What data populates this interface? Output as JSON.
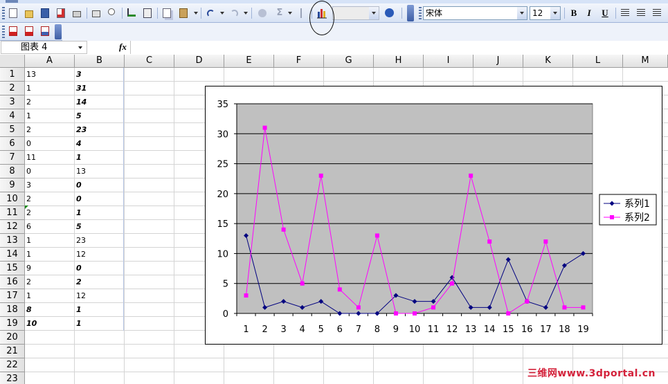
{
  "toolbar": {
    "font_name": "宋体",
    "font_size": "12",
    "bold_label": "B",
    "italic_label": "I",
    "underline_label": "U",
    "autosum_label": "Σ",
    "icons": [
      "new-icon",
      "open-icon",
      "save-icon",
      "permission-icon",
      "print-icon",
      "print-preview-icon",
      "spelling-icon",
      "research-icon",
      "copy-icon",
      "paste-icon",
      "undo-icon",
      "redo-icon",
      "hyperlink-icon",
      "autosum-icon",
      "sort-icon",
      "chart-wizard-icon",
      "help-icon"
    ],
    "pdf_icons": [
      "pdf-convert-icon",
      "pdf-email-icon",
      "pdf-review-icon"
    ]
  },
  "formula_bar": {
    "name_box": "图表 4",
    "fx_label": "fx",
    "formula": ""
  },
  "columns": [
    "A",
    "B",
    "C",
    "D",
    "E",
    "F",
    "G",
    "H",
    "I",
    "J",
    "K",
    "L",
    "M"
  ],
  "rows": [
    "1",
    "2",
    "3",
    "4",
    "5",
    "6",
    "7",
    "8",
    "9",
    "10",
    "11",
    "12",
    "13",
    "14",
    "15",
    "16",
    "17",
    "18",
    "19",
    "20",
    "21",
    "22",
    "23"
  ],
  "sheet": {
    "col_a": [
      "13",
      "1",
      "2",
      "1",
      "2",
      "0",
      "11",
      "0",
      "3",
      "2",
      "2",
      "6",
      "1",
      "1",
      "9",
      "2",
      "1",
      "8",
      "10"
    ],
    "col_b": [
      "3",
      "31",
      "14",
      "5",
      "23",
      "4",
      "1",
      "13",
      "0",
      "0",
      "1",
      "5",
      "23",
      "12",
      "0",
      "2",
      "12",
      "1",
      "1"
    ],
    "col_a_bold_italic": [
      false,
      false,
      false,
      false,
      false,
      false,
      false,
      false,
      false,
      false,
      false,
      false,
      false,
      false,
      false,
      false,
      false,
      true,
      true
    ],
    "col_b_bold_italic": [
      true,
      true,
      true,
      true,
      true,
      true,
      true,
      false,
      true,
      true,
      true,
      true,
      false,
      false,
      true,
      true,
      false,
      true,
      true
    ]
  },
  "chart_data": {
    "type": "line",
    "x": [
      1,
      2,
      3,
      4,
      5,
      6,
      7,
      8,
      9,
      10,
      11,
      12,
      13,
      14,
      15,
      16,
      17,
      18,
      19
    ],
    "x_tick_labels": [
      "1",
      "2",
      "3",
      "4",
      "5",
      "6",
      "7",
      "8",
      "9",
      "10",
      "11",
      "12",
      "13",
      "14",
      "15",
      "16",
      "17",
      "18",
      "19"
    ],
    "y_tick_labels": [
      "0",
      "5",
      "10",
      "15",
      "20",
      "25",
      "30",
      "35"
    ],
    "ylim": [
      0,
      35
    ],
    "y_major_unit": 5,
    "grid": true,
    "plot_area_color": "#c0c0c0",
    "legend_position": "right",
    "title": "",
    "xlabel": "",
    "ylabel": "",
    "series": [
      {
        "name": "系列1",
        "color": "#000080",
        "marker": "diamond",
        "values": [
          13,
          1,
          2,
          1,
          2,
          0,
          0,
          0,
          3,
          2,
          2,
          6,
          1,
          1,
          9,
          2,
          1,
          8,
          10
        ]
      },
      {
        "name": "系列2",
        "color": "#ff00ff",
        "marker": "square",
        "values": [
          3,
          31,
          14,
          5,
          23,
          4,
          1,
          13,
          0,
          0,
          1,
          5,
          23,
          12,
          0,
          2,
          12,
          1,
          1
        ]
      }
    ]
  },
  "watermark": "三维网www.3dportal.cn"
}
